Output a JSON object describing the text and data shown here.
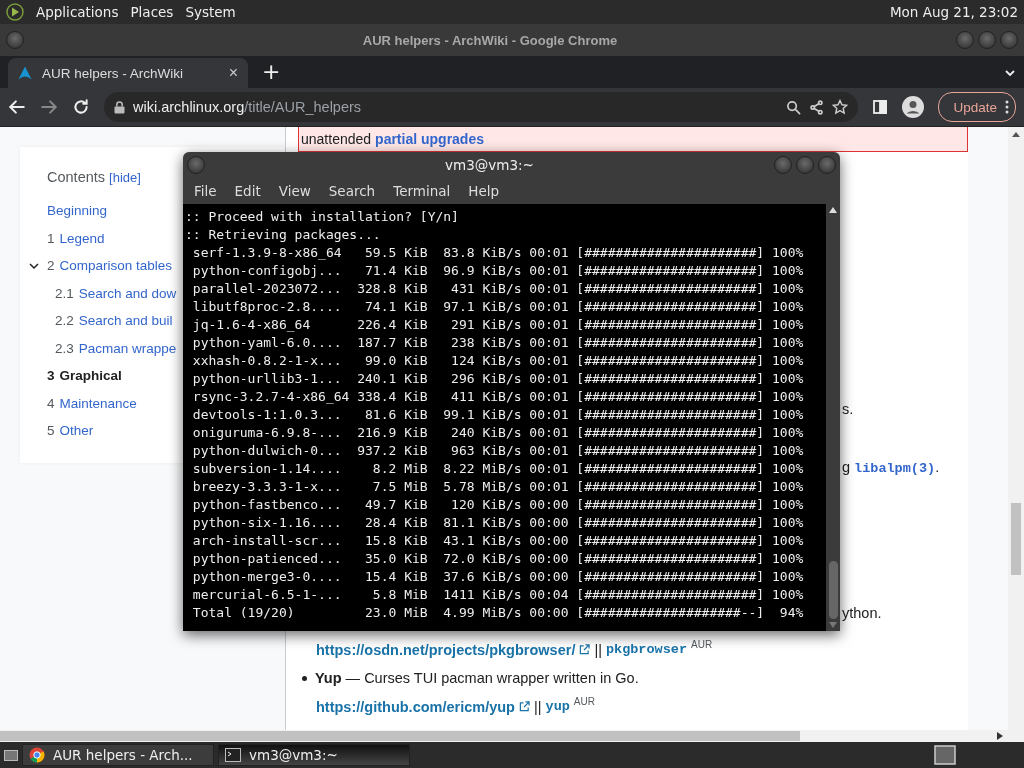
{
  "top_panel": {
    "menus": [
      "Applications",
      "Places",
      "System"
    ],
    "clock": "Mon Aug 21, 23:02"
  },
  "browser": {
    "window_title": "AUR helpers - ArchWiki - Google Chrome",
    "tabs": [
      {
        "title": "AUR helpers - ArchWiki",
        "close": "×",
        "selected": true
      }
    ],
    "new_tab": "+",
    "url_host": "wiki.archlinux.org",
    "url_path": "/title/AUR_helpers",
    "update_button": "Update"
  },
  "toc": {
    "title": "Contents",
    "hide_link": "[hide]",
    "items": [
      {
        "label": "Beginning",
        "selected": false
      },
      {
        "number": "1",
        "label": "Legend",
        "selected": false
      },
      {
        "number": "2",
        "label": "Comparison tables",
        "selected": false,
        "expanded": true,
        "children": [
          {
            "number": "2.1",
            "label": "Search and dow",
            "selected": false
          },
          {
            "number": "2.2",
            "label": "Search and buil",
            "selected": false
          },
          {
            "number": "2.3",
            "label": "Pacman wrappe",
            "selected": false
          }
        ]
      },
      {
        "number": "3",
        "label": "Graphical",
        "selected": true
      },
      {
        "number": "4",
        "label": "Maintenance",
        "selected": false
      },
      {
        "number": "5",
        "label": "Other",
        "selected": false
      }
    ]
  },
  "article": {
    "notice_text": "unattended",
    "notice_link": "partial upgrades",
    "fragment_1": "s.",
    "fragment_2": {
      "text": "g",
      "code": "libalpm(3)",
      "after": "."
    },
    "fragment_3": "ython.",
    "entries": [
      {
        "kind": "link_line",
        "url": "https://osdn.net/projects/pkgbrowser/",
        "separator": "||",
        "package": "pkgbrowser",
        "repo": "AUR"
      },
      {
        "kind": "bullet",
        "text": "**Yup** — Curses TUI pacman wrapper written in Go."
      },
      {
        "kind": "link_line",
        "url": "https://github.com/ericm/yup",
        "separator": "||",
        "package": "yup",
        "repo": "AUR"
      }
    ]
  },
  "terminal": {
    "title": "vm3@vm3:~",
    "menus": [
      "File",
      "Edit",
      "View",
      "Search",
      "Terminal",
      "Help"
    ],
    "lines": [
      ":: Proceed with installation? [Y/n]",
      ":: Retrieving packages...",
      " serf-1.3.9-8-x86_64   59.5 KiB  83.8 KiB/s 00:01 [######################] 100%",
      " python-configobj...   71.4 KiB  96.9 KiB/s 00:01 [######################] 100%",
      " parallel-2023072...  328.8 KiB   431 KiB/s 00:01 [######################] 100%",
      " libutf8proc-2.8....   74.1 KiB  97.1 KiB/s 00:01 [######################] 100%",
      " jq-1.6-4-x86_64      226.4 KiB   291 KiB/s 00:01 [######################] 100%",
      " python-yaml-6.0....  187.7 KiB   238 KiB/s 00:01 [######################] 100%",
      " xxhash-0.8.2-1-x...   99.0 KiB   124 KiB/s 00:01 [######################] 100%",
      " python-urllib3-1...  240.1 KiB   296 KiB/s 00:01 [######################] 100%",
      " rsync-3.2.7-4-x86_64 338.4 KiB   411 KiB/s 00:01 [######################] 100%",
      " devtools-1:1.0.3...   81.6 KiB  99.1 KiB/s 00:01 [######################] 100%",
      " oniguruma-6.9.8-...  216.9 KiB   240 KiB/s 00:01 [######################] 100%",
      " python-dulwich-0...  937.2 KiB   963 KiB/s 00:01 [######################] 100%",
      " subversion-1.14....    8.2 MiB  8.22 MiB/s 00:01 [######################] 100%",
      " breezy-3.3.3-1-x...    7.5 MiB  5.78 MiB/s 00:01 [######################] 100%",
      " python-fastbenco...   49.7 KiB   120 KiB/s 00:00 [######################] 100%",
      " python-six-1.16....   28.4 KiB  81.1 KiB/s 00:00 [######################] 100%",
      " arch-install-scr...   15.8 KiB  43.1 KiB/s 00:00 [######################] 100%",
      " python-patienced...   35.0 KiB  72.0 KiB/s 00:00 [######################] 100%",
      " python-merge3-0....   15.4 KiB  37.6 KiB/s 00:00 [######################] 100%",
      " mercurial-6.5-1-...    5.8 MiB  1411 KiB/s 00:04 [######################] 100%",
      " Total (19/20)         23.0 MiB  4.99 MiB/s 00:00 [####################--]  94%"
    ]
  },
  "taskbar": {
    "tasks": [
      {
        "kind": "browser",
        "label": "AUR helpers - Arch...",
        "selected": false
      },
      {
        "kind": "terminal",
        "label": "vm3@vm3:~",
        "selected": true
      }
    ]
  }
}
